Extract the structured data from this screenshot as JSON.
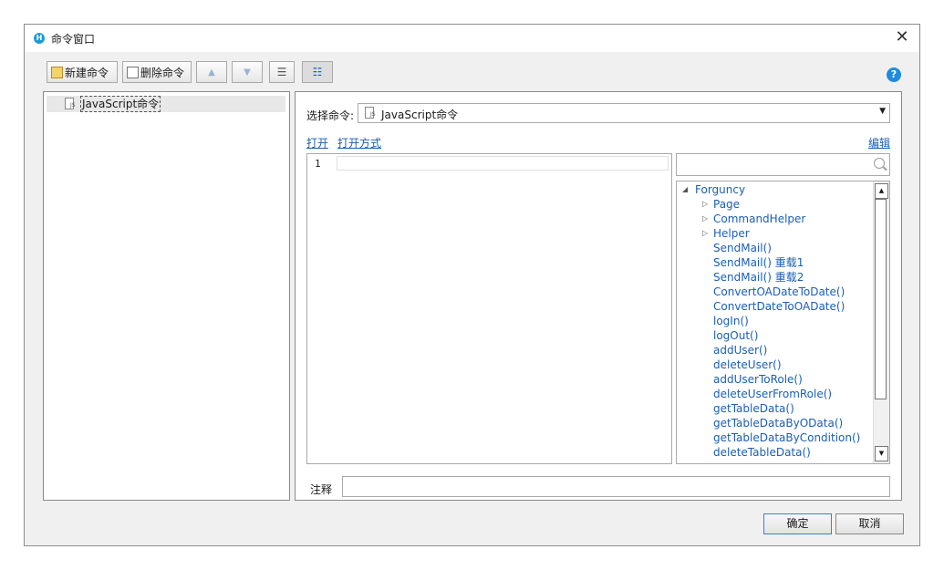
{
  "window": {
    "title": "命令窗口",
    "app_icon_letter": "H"
  },
  "toolbar": {
    "new_label": "新建命令",
    "delete_label": "删除命令"
  },
  "left_tree": {
    "items": [
      {
        "label": "JavaScript命令",
        "icon": "js-file-icon",
        "icon_text": "JS"
      }
    ]
  },
  "command": {
    "select_label": "选择命令:",
    "selected_value": "JavaScript命令"
  },
  "links": {
    "open": "打开",
    "open_with": "打开方式",
    "edit": "编辑"
  },
  "editor": {
    "line_number": "1"
  },
  "api_tree": {
    "root": "Forguncy",
    "groups": [
      "Page",
      "CommandHelper",
      "Helper"
    ],
    "methods": [
      "SendMail()",
      "SendMail() 重载1",
      "SendMail() 重载2",
      "ConvertOADateToDate()",
      "ConvertDateToOADate()",
      "logIn()",
      "logOut()",
      "addUser()",
      "deleteUser()",
      "addUserToRole()",
      "deleteUserFromRole()",
      "getTableData()",
      "getTableDataByOData()",
      "getTableDataByCondition()",
      "deleteTableData()"
    ]
  },
  "note": {
    "label": "注释"
  },
  "footer": {
    "ok": "确定",
    "cancel": "取消"
  },
  "colors": {
    "accent": "#1f8be0",
    "link": "#1a5fb4"
  }
}
